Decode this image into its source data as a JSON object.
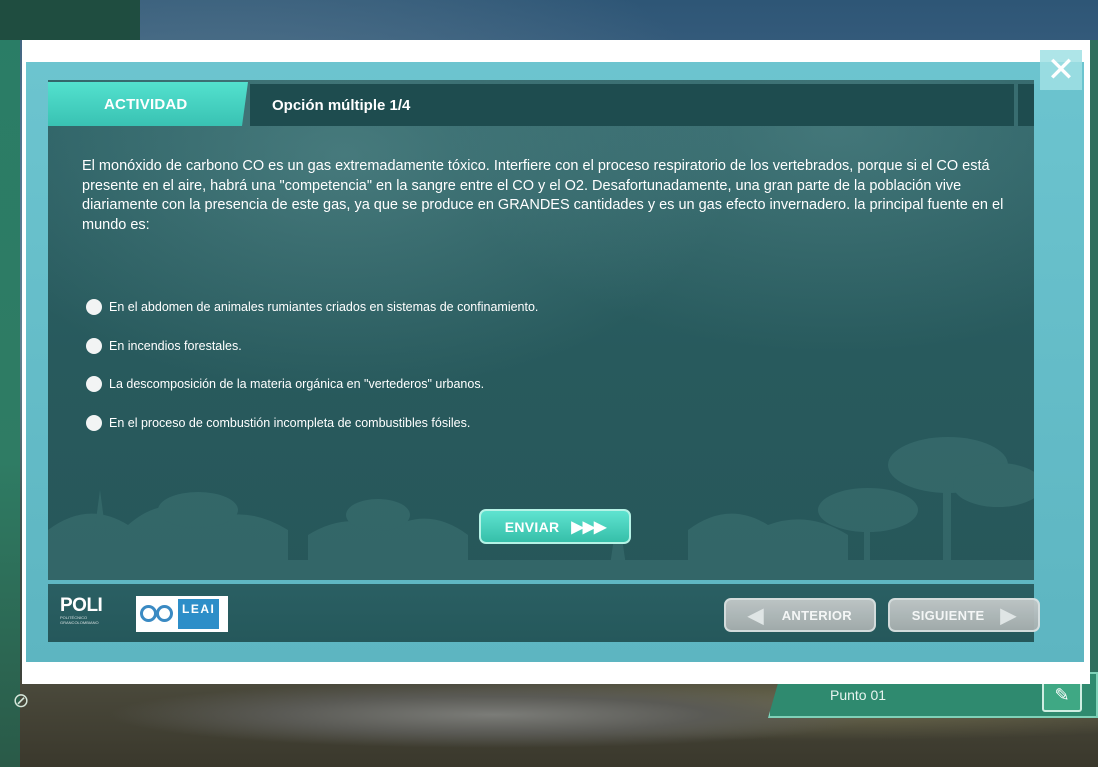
{
  "background": {
    "punto_label": "Punto 01",
    "punto_button_icon": "pencil-icon",
    "left_icon": "no-entry-icon"
  },
  "modal": {
    "close_icon": "close-icon",
    "header": {
      "section_label": "ACTIVIDAD",
      "title": "Opción múltiple 1/4"
    },
    "question": "El monóxido de carbono CO es un gas extremadamente tóxico. Interfiere con el proceso respiratorio de los vertebrados, porque si el CO está presente en el aire, habrá una \"competencia\" en la sangre entre el CO y el O2. Desafortunadamente, una gran parte de la población vive diariamente con la presencia de este gas, ya que se produce en GRANDES cantidades y es un gas efecto invernadero. la principal fuente en el mundo es:",
    "options": [
      {
        "label": "En el abdomen de animales rumiantes criados en sistemas de confinamiento."
      },
      {
        "label": "En incendios forestales."
      },
      {
        "label": "La descomposición de la materia orgánica en \"vertederos\" urbanos."
      },
      {
        "label": "En el proceso de combustión incompleta de combustibles fósiles."
      }
    ],
    "submit": {
      "label": "ENVIAR",
      "arrows": "▶▶▶"
    },
    "footer": {
      "logo_poli": "POLI",
      "logo_poli_sub": "POLITÉCNICO GRANCOLOMBIANO",
      "logo_leai": "LEAI",
      "prev_label": "ANTERIOR",
      "next_label": "SIGUIENTE"
    }
  },
  "colors": {
    "accent": "#39c2b3",
    "panel": "#285a5d",
    "frame": "#6cc4cf",
    "disabled_button": "#a7afaf"
  }
}
